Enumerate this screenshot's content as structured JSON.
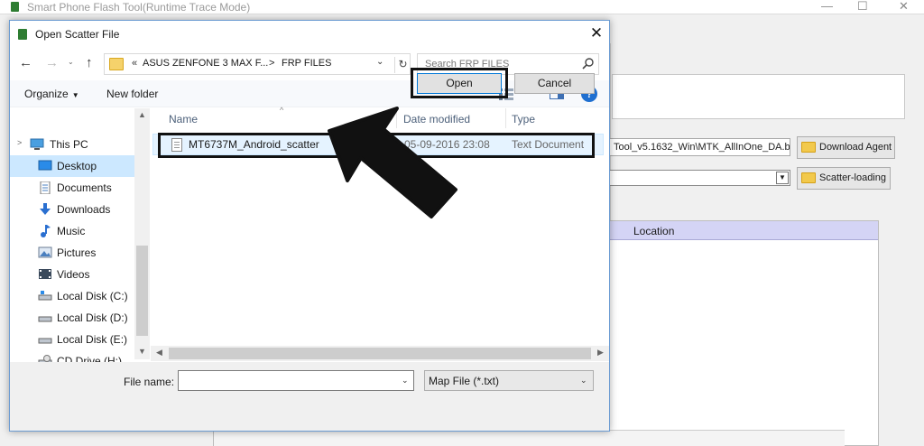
{
  "background_app": {
    "title": "Smart Phone Flash Tool(Runtime Trace Mode)",
    "window_controls": {
      "minimize": "—",
      "maximize": "☐",
      "close": "✕"
    },
    "da_path": "Tool_v5.1632_Win\\MTK_AllInOne_DA.bin",
    "download_agent_label": "Download Agent",
    "scatter_loading_label": "Scatter-loading",
    "location_header": "Location"
  },
  "dialog": {
    "title": "Open Scatter File",
    "close_glyph": "✕",
    "nav": {
      "back": "←",
      "forward": "→",
      "recent": "⌄",
      "up": "↑"
    },
    "address": {
      "overflow": "«",
      "crumbs": [
        "ASUS ZENFONE 3 MAX F...",
        "FRP FILES"
      ],
      "separator": ">",
      "dropdown": "⌄",
      "refresh": "↻"
    },
    "search": {
      "placeholder": "Search FRP FILES"
    },
    "toolbar": {
      "organize": "Organize",
      "new_folder": "New folder",
      "help": "?",
      "view_arrow": "▼"
    },
    "nav_pane": {
      "items": [
        {
          "label": "This PC",
          "icon": "pc-icon"
        },
        {
          "label": "Desktop",
          "icon": "desktop-icon",
          "selected": true
        },
        {
          "label": "Documents",
          "icon": "documents-icon"
        },
        {
          "label": "Downloads",
          "icon": "downloads-icon"
        },
        {
          "label": "Music",
          "icon": "music-icon"
        },
        {
          "label": "Pictures",
          "icon": "pictures-icon"
        },
        {
          "label": "Videos",
          "icon": "videos-icon"
        },
        {
          "label": "Local Disk (C:)",
          "icon": "disk-icon"
        },
        {
          "label": "Local Disk (D:)",
          "icon": "disk-icon"
        },
        {
          "label": "Local Disk (E:)",
          "icon": "disk-icon"
        },
        {
          "label": "CD Drive (H:)",
          "icon": "cd-drive-icon"
        }
      ]
    },
    "columns": [
      "Name",
      "Date modified",
      "Type"
    ],
    "files": [
      {
        "name": "MT6737M_Android_scatter",
        "date": "05-09-2016 23:08",
        "type": "Text Document"
      }
    ],
    "bottom": {
      "file_name_label": "File name:",
      "file_name_value": "",
      "file_type_selected": "Map File (*.txt)",
      "open_label": "Open",
      "cancel_label": "Cancel"
    }
  },
  "colors": {
    "selection": "#cce8ff",
    "dialog_border": "#6b9bd2",
    "accent": "#0078d7",
    "location_header": "#d4d4f5"
  }
}
